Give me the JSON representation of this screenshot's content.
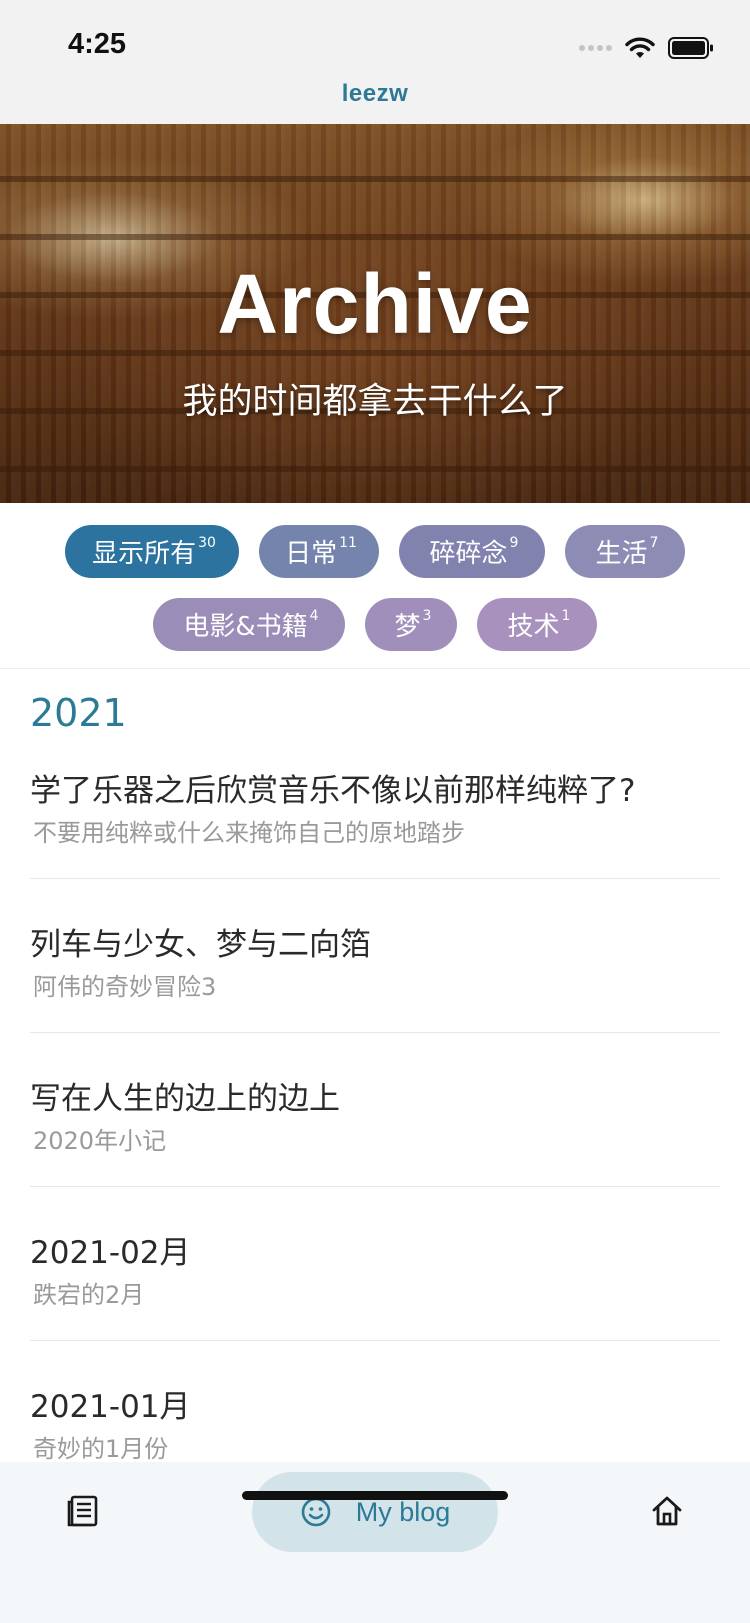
{
  "status_bar": {
    "time": "4:25"
  },
  "nav": {
    "title": "leezw"
  },
  "hero": {
    "title": "Archive",
    "subtitle": "我的时间都拿去干什么了"
  },
  "tags": [
    {
      "label": "显示所有",
      "count": "30",
      "color": "#2c73a0"
    },
    {
      "label": "日常",
      "count": "11",
      "color": "#7584ad"
    },
    {
      "label": "碎碎念",
      "count": "9",
      "color": "#8183ae"
    },
    {
      "label": "生活",
      "count": "7",
      "color": "#8d8cb5"
    },
    {
      "label": "电影&书籍",
      "count": "4",
      "color": "#9a8db8"
    },
    {
      "label": "梦",
      "count": "3",
      "color": "#a18fbb"
    },
    {
      "label": "技术",
      "count": "1",
      "color": "#a892bd"
    }
  ],
  "archive": {
    "year": "2021",
    "posts": [
      {
        "title": "学了乐器之后欣赏音乐不像以前那样纯粹了?",
        "desc": "不要用纯粹或什么来掩饰自己的原地踏步"
      },
      {
        "title": "列车与少女、梦与二向箔",
        "desc": "阿伟的奇妙冒险3"
      },
      {
        "title": "写在人生的边上的边上",
        "desc": "2020年小记"
      },
      {
        "title": "2021-02月",
        "desc": "跌宕的2月"
      },
      {
        "title": "2021-01月",
        "desc": "奇妙的1月份"
      }
    ]
  },
  "bottom_nav": {
    "left_icon": "article-list-icon",
    "pill_icon": "smiley-icon",
    "pill_label": "My blog",
    "right_icon": "home-icon",
    "accent": "#2c7a96"
  }
}
